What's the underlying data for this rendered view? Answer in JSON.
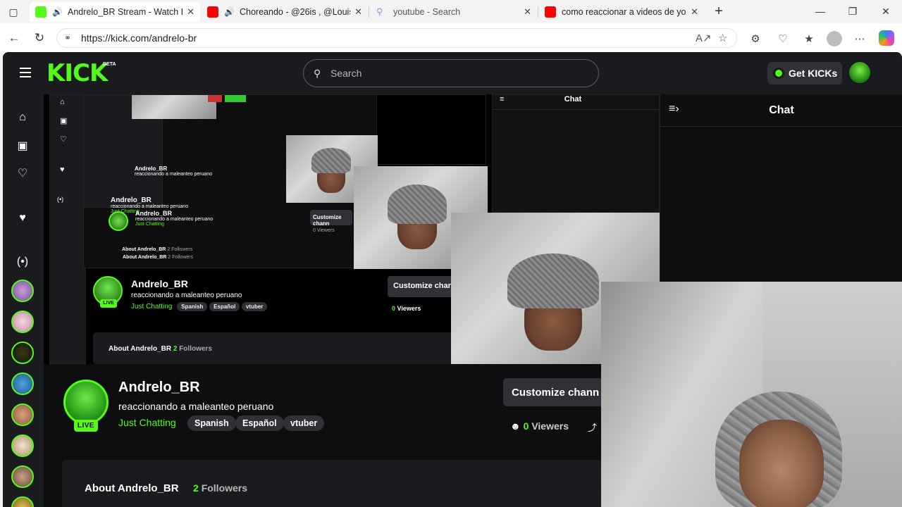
{
  "browser": {
    "tabs": [
      {
        "title": "Andrelo_BR Stream - Watch Li",
        "favicon_color": "#53fc18",
        "active": true,
        "audio": true
      },
      {
        "title": "Choreando - @26is , @Louis",
        "favicon_color": "#ff0000",
        "active": false,
        "audio": true
      },
      {
        "title": "youtube - Search",
        "favicon_color": "#9aa4ff",
        "active": false,
        "audio": false
      },
      {
        "title": "como reaccionar a videos de yout",
        "favicon_color": "#ff0000",
        "active": false,
        "audio": false
      }
    ],
    "url": "https://kick.com/andrelo-br"
  },
  "kick": {
    "logo": "KICK",
    "beta": "BETA",
    "search_placeholder": "Search",
    "get_kicks": "Get KICKs",
    "accent": "#53fc18",
    "channel": {
      "name": "Andrelo_BR",
      "title": "reaccionando a maleanteo peruano",
      "category": "Just Chatting",
      "tags": [
        "Spanish",
        "Español",
        "vtuber"
      ],
      "live_label": "LIVE",
      "customize_label": "Customize chann",
      "viewers_count": "0",
      "viewers_label": "Viewers",
      "about_label": "About Andrelo_BR",
      "followers_count": "2",
      "followers_label": "Followers"
    },
    "chat": {
      "title": "Chat"
    }
  }
}
